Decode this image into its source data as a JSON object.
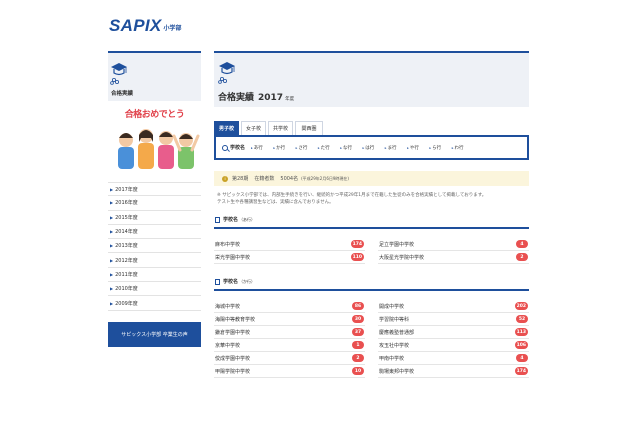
{
  "logo": {
    "brand": "SAPIX",
    "sub": "小学部"
  },
  "sidebar": {
    "title": "合格実績",
    "banner_title": "合格おめでとう",
    "years": [
      "2017年度",
      "2016年度",
      "2015年度",
      "2014年度",
      "2013年度",
      "2012年度",
      "2011年度",
      "2010年度",
      "2009年度"
    ],
    "voice_button": "サピックス小学部 卒業生の声"
  },
  "main": {
    "title": "合格実績",
    "year": "2017",
    "year_suffix": "年度",
    "tabs": [
      "男子校",
      "女子校",
      "共学校",
      "関西圏"
    ],
    "filter_label": "学校名",
    "filters": [
      "あ行",
      "か行",
      "さ行",
      "た行",
      "な行",
      "は行",
      "ま行",
      "や行",
      "ら行",
      "わ行"
    ],
    "notice": {
      "term": "第28期",
      "count_label": "在籍者数",
      "count": "5004名",
      "note": "(平成29年2月6日9時現在)"
    },
    "note_lines": [
      "※ サピックス小学部では、内部生手続きを行い、継続的かつ平成29年1月まで在籍した生徒のみを合格実績として掲載しております。",
      "テスト生や各種講習生などは、実績に含んでおりません。"
    ],
    "sections": [
      {
        "title": "学校名",
        "sub": "（あ行）",
        "left": [
          {
            "name": "麻布中学校",
            "count": "174"
          },
          {
            "name": "栄光学園中学校",
            "count": "110"
          }
        ],
        "right": [
          {
            "name": "足立学園中学校",
            "count": "4"
          },
          {
            "name": "大阪星光学院中学校",
            "count": "2"
          }
        ]
      },
      {
        "title": "学校名",
        "sub": "（か行）",
        "left": [
          {
            "name": "海城中学校",
            "count": "86"
          },
          {
            "name": "海陽中等教育学校",
            "count": "30"
          },
          {
            "name": "鎌倉学園中学校",
            "count": "37"
          },
          {
            "name": "京華中学校",
            "count": "1"
          },
          {
            "name": "佼成学園中学校",
            "count": "2"
          },
          {
            "name": "甲陽学院中学校",
            "count": "10"
          }
        ],
        "right": [
          {
            "name": "開成中学校",
            "count": "202"
          },
          {
            "name": "学習院中等科",
            "count": "52"
          },
          {
            "name": "慶應義塾普通部",
            "count": "113"
          },
          {
            "name": "攻玉社中学校",
            "count": "106"
          },
          {
            "name": "甲南中学校",
            "count": "4"
          },
          {
            "name": "駒場東邦中学校",
            "count": "174"
          }
        ]
      }
    ]
  },
  "colors": {
    "brand": "#1e4f9c",
    "badge": "#e95050",
    "notice_bg": "#fbf5dc"
  }
}
